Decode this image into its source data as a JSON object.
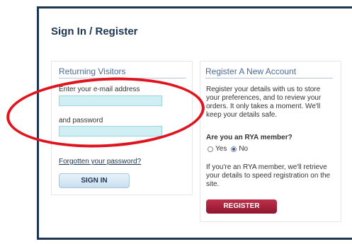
{
  "page": {
    "title": "Sign In / Register"
  },
  "returning": {
    "title": "Returning Visitors",
    "email_label": "Enter your e-mail address",
    "email_value": "",
    "password_label": "and password",
    "password_value": "",
    "forgot_link": "Forgotten your password?",
    "signin_button": "SIGN IN"
  },
  "register": {
    "title": "Register A New Account",
    "description": "Register your details with us to store your preferences, and to review your orders. It only takes a moment. We'll keep your details safe.",
    "member_question": "Are you an RYA member?",
    "options": [
      {
        "label": "Yes",
        "checked": false
      },
      {
        "label": "No",
        "checked": true
      }
    ],
    "member_note": "If you're an RYA member, we'll retrieve your details to speed registration on the site.",
    "register_button": "REGISTER"
  },
  "annotation": {
    "color": "#e0141e"
  }
}
